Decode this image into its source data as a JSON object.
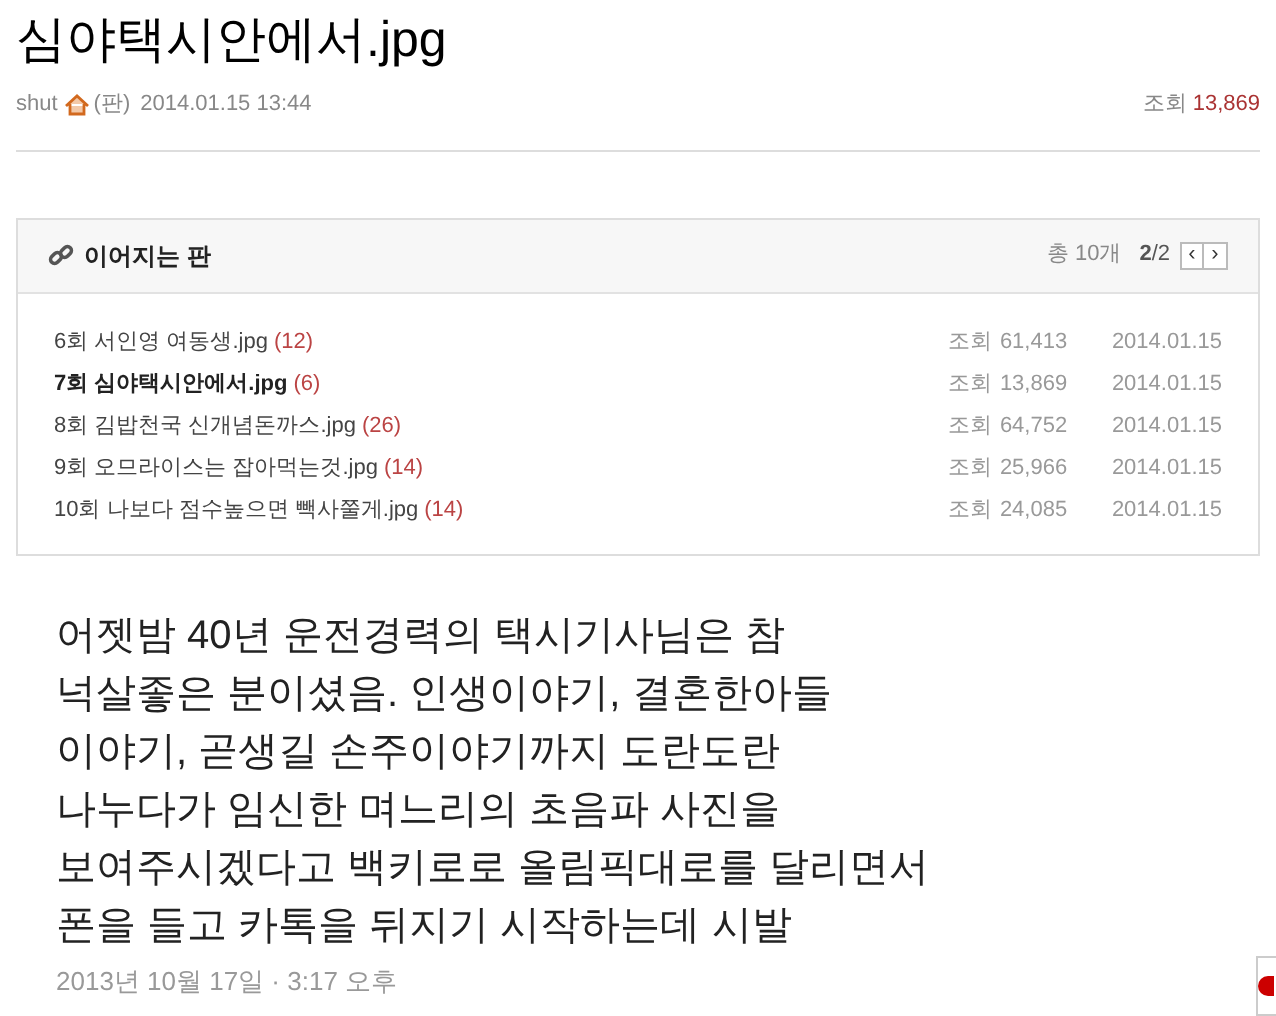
{
  "post": {
    "title": "심야택시안에서.jpg",
    "author": "shut",
    "board": "(판)",
    "datetime": "2014.01.15 13:44",
    "views_label": "조회",
    "views": "13,869"
  },
  "series": {
    "title": "이어지는 판",
    "total": "총 10개",
    "page_current": "2",
    "page_total": "/2",
    "prev": "‹",
    "next": "›",
    "items": [
      {
        "title": "6회 서인영 여동생.jpg",
        "comments": "(12)",
        "views_label": "조회",
        "views": "61,413",
        "date": "2014.01.15",
        "selected": false
      },
      {
        "title": "7회 심야택시안에서.jpg",
        "comments": "(6)",
        "views_label": "조회",
        "views": "13,869",
        "date": "2014.01.15",
        "selected": true
      },
      {
        "title": "8회 김밥천국 신개념돈까스.jpg",
        "comments": "(26)",
        "views_label": "조회",
        "views": "64,752",
        "date": "2014.01.15",
        "selected": false
      },
      {
        "title": "9회 오므라이스는 잡아먹는것.jpg",
        "comments": "(14)",
        "views_label": "조회",
        "views": "25,966",
        "date": "2014.01.15",
        "selected": false
      },
      {
        "title": "10회 나보다 점수높으면 빽사쭐게.jpg",
        "comments": "(14)",
        "views_label": "조회",
        "views": "24,085",
        "date": "2014.01.15",
        "selected": false
      }
    ]
  },
  "body": {
    "lines": [
      "어젯밤 40년 운전경력의 택시기사님은 참",
      "넉살좋은 분이셨음. 인생이야기, 결혼한아들",
      "이야기, 곧생길 손주이야기까지 도란도란",
      "나누다가 임신한 며느리의 초음파 사진을",
      "보여주시겠다고 백키로로 올림픽대로를 달리면서",
      "폰을 들고 카톡을 뒤지기 시작하는데 시발"
    ],
    "timestamp": "2013년 10월 17일 · 3:17 오후"
  }
}
